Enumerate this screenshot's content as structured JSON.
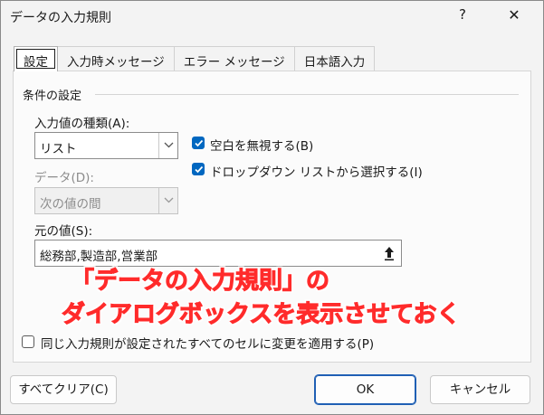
{
  "window": {
    "title": "データの入力規則",
    "help_label": "?",
    "close_label": "✕"
  },
  "tabs": [
    {
      "label": "設定",
      "active": true
    },
    {
      "label": "入力時メッセージ",
      "active": false
    },
    {
      "label": "エラー メッセージ",
      "active": false
    },
    {
      "label": "日本語入力",
      "active": false
    }
  ],
  "conditions": {
    "group_label": "条件の設定",
    "allow_label": "入力値の種類(A):",
    "allow_value": "リスト",
    "data_label": "データ(D):",
    "data_value": "次の値の間",
    "ignore_blank": {
      "label": "空白を無視する(B)",
      "checked": true
    },
    "in_cell_dropdown": {
      "label": "ドロップダウン リストから選択する(I)",
      "checked": true
    },
    "source_label": "元の値(S):",
    "source_value": "総務部,製造部,営業部"
  },
  "annotation": {
    "line1": "「データの入力規則」の",
    "line2": "ダイアログボックスを表示させておく",
    "color": "#ff2b2b"
  },
  "apply_all": {
    "label": "同じ入力規則が設定されたすべてのセルに変更を適用する(P)",
    "checked": false
  },
  "buttons": {
    "clear_all": "すべてクリア(C)",
    "ok": "OK",
    "cancel": "キャンセル"
  },
  "colors": {
    "accent": "#0067c0",
    "background": "#f3f3f3"
  }
}
